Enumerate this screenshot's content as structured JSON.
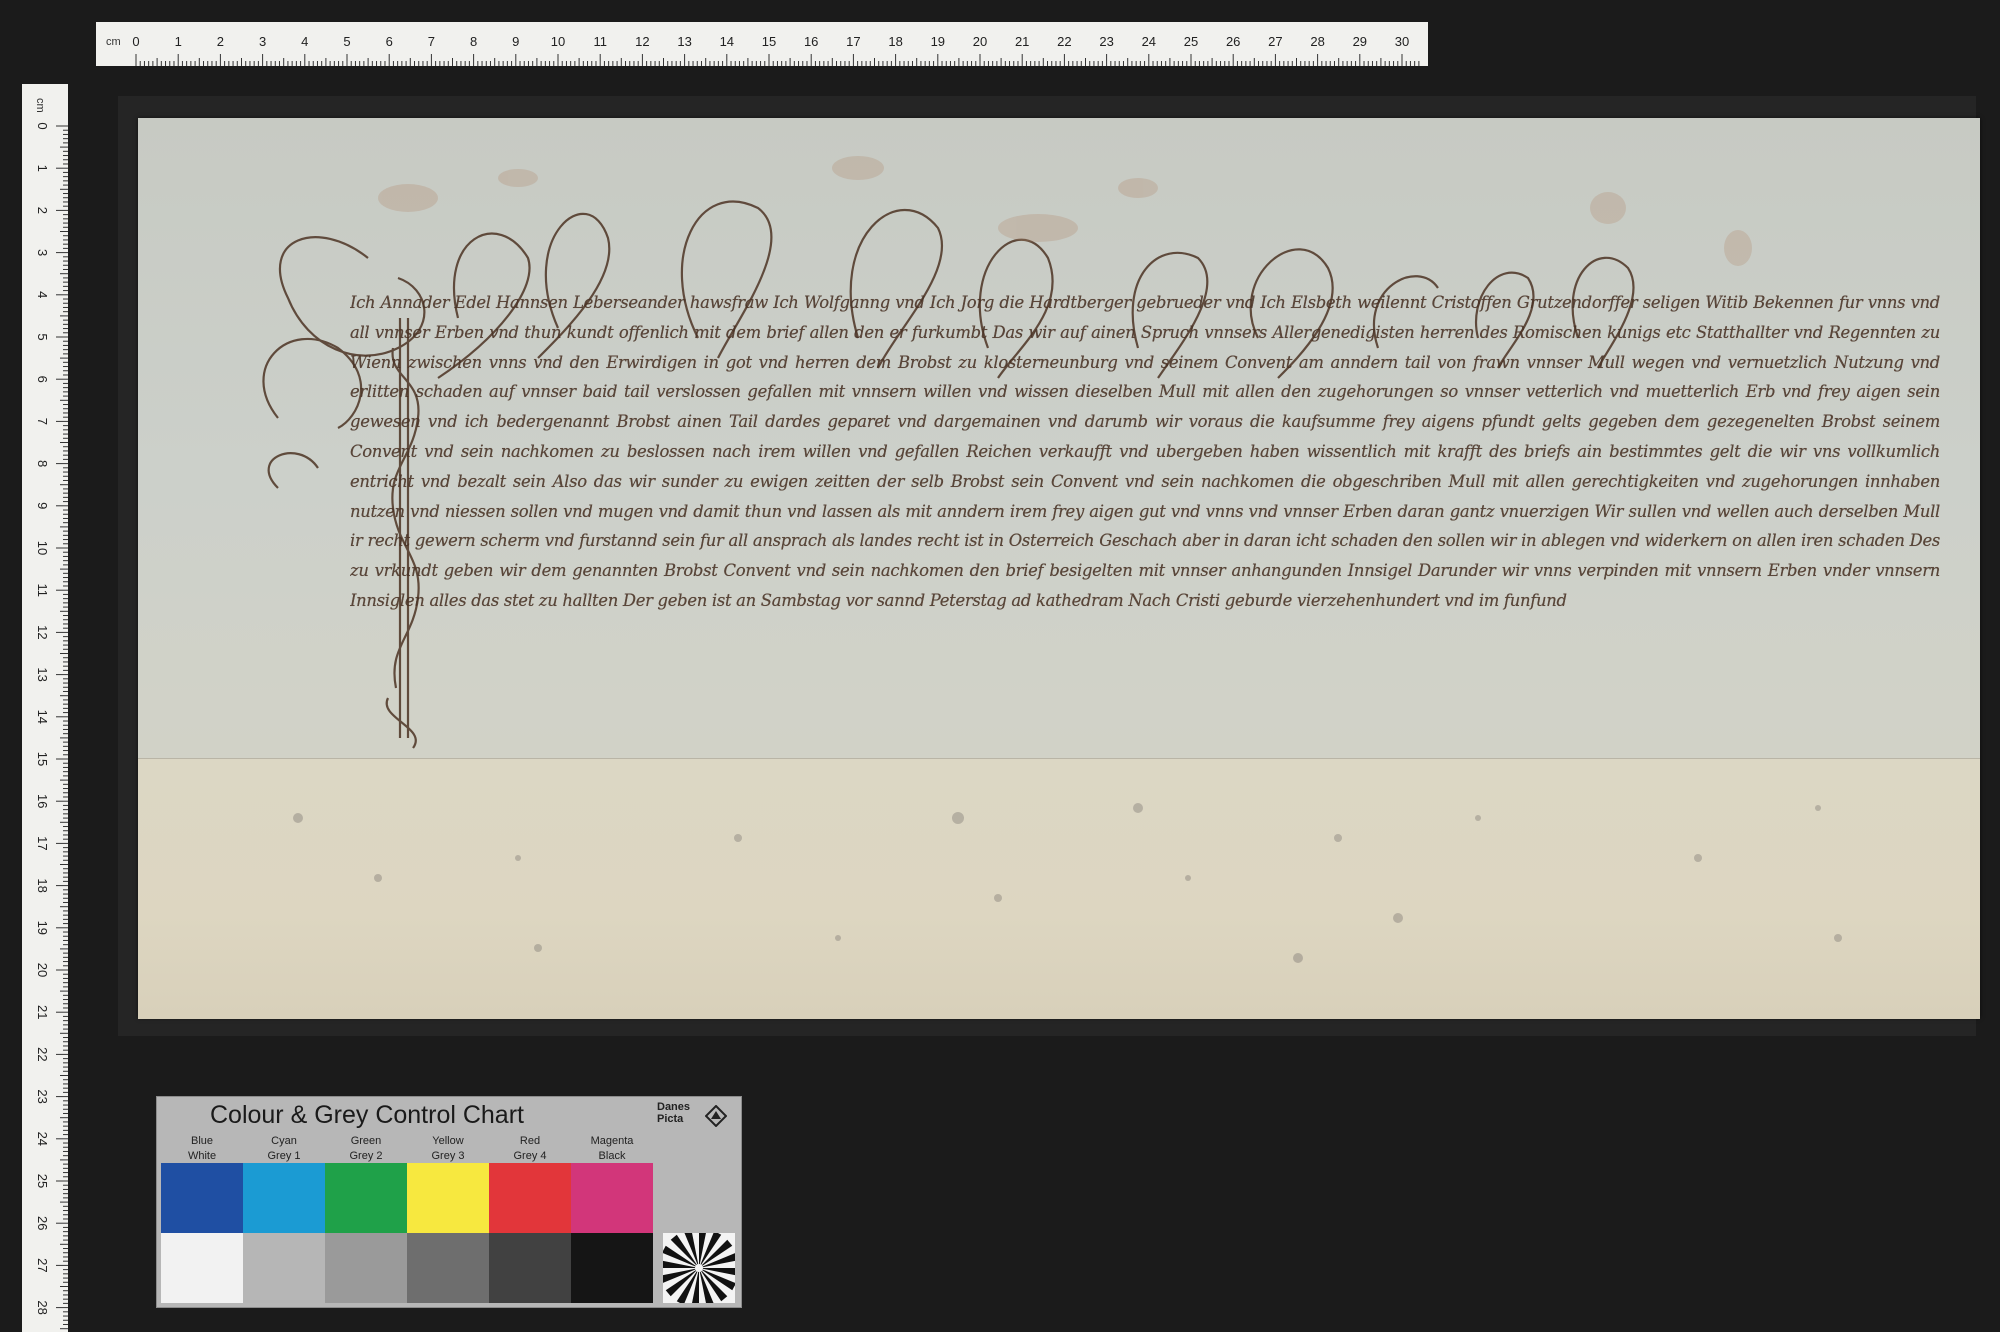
{
  "ruler_horizontal": {
    "unit": "cm",
    "labels": [
      "0",
      "1",
      "2",
      "3",
      "4",
      "5",
      "6",
      "7",
      "8",
      "9",
      "10",
      "11",
      "12",
      "13",
      "14",
      "15",
      "16",
      "17",
      "18",
      "19",
      "20",
      "21",
      "22",
      "23",
      "24",
      "25",
      "26",
      "27",
      "28",
      "29",
      "30"
    ]
  },
  "ruler_vertical": {
    "unit": "cm",
    "labels": [
      "0",
      "1",
      "2",
      "3",
      "4",
      "5",
      "6",
      "7",
      "8",
      "9",
      "10",
      "11",
      "12",
      "13",
      "14",
      "15",
      "16",
      "17",
      "18",
      "19",
      "20",
      "21",
      "22",
      "23",
      "24",
      "25",
      "26",
      "27",
      "28"
    ]
  },
  "charter": {
    "text": "Ich Annader Edel Hannsen Leberseander hawsfraw Ich Wolfganng vnd Ich Jorg die Hardtberger gebrueder vnd Ich Elsbeth weilennt Cristoffen Grutzendorffer seligen Witib Bekennen fur vnns vnd all vnnser Erben vnd thun kundt offenlich mit dem brief allen den er furkumbt Das wir auf ainen Spruch vnnsers Allergenedigisten herren des Romischen kunigs etc Statthallter vnd Regennten zu Wienn zwischen vnns vnd den Erwirdigen in got vnd herren dem Brobst zu klosterneunburg vnd seinem Convent am anndern tail von frawn vnnser Mull wegen vnd vernuetzlich Nutzung vnd erlitten schaden auf vnnser baid tail verslossen gefallen mit vnnsern willen vnd wissen dieselben Mull mit allen den zugehorungen so vnnser vetterlich vnd muetterlich Erb vnd frey aigen sein gewesen vnd ich bedergenannt Brobst ainen Tail dardes geparet vnd dargemainen vnd darumb wir voraus die kaufsumme frey aigens pfundt gelts gegeben dem gezegenelten Brobst seinem Convent vnd sein nachkomen zu beslossen nach irem willen vnd gefallen Reichen verkaufft vnd ubergeben haben wissentlich mit krafft des briefs ain bestimmtes gelt die wir vns vollkumlich entricht vnd bezalt sein Also das wir sunder zu ewigen zeitten der selb Brobst sein Convent vnd sein nachkomen die obgeschriben Mull mit allen gerechtigkeiten vnd zugehorungen innhaben nutzen vnd niessen sollen vnd mugen vnd damit thun vnd lassen als mit anndern irem frey aigen gut vnd vnns vnd vnnser Erben daran gantz vnuerzigen Wir sullen vnd wellen auch derselben Mull ir recht gewern scherm vnd furstannd sein fur all ansprach als landes recht ist in Osterreich Geschach aber in daran icht schaden den sollen wir in ablegen vnd widerkern on allen iren schaden Des zu vrkundt geben wir dem genannten Brobst Convent vnd sein nachkomen den brief besigelten mit vnnser anhangunden Innsigel Darunder wir vnns verpinden mit vnnsern Erben vnder vnnsern Innsiglen alles das stet zu hallten Der geben ist an Sambstag vor sannd Peterstag ad kathedram Nach Cristi geburde vierzehenhundert vnd im funfund"
  },
  "color_chart": {
    "title": "Colour & Grey Control Chart",
    "brand": "Danes\nPicta",
    "top_labels": [
      "Blue",
      "Cyan",
      "Green",
      "Yellow",
      "Red",
      "Magenta"
    ],
    "bottom_labels": [
      "White",
      "Grey 1",
      "Grey 2",
      "Grey 3",
      "Grey 4",
      "Black"
    ],
    "colors": [
      "#1f4fa3",
      "#1b9bd3",
      "#1fa149",
      "#f7e83f",
      "#e2363a",
      "#d2367a"
    ],
    "greys": [
      "#f2f2f2",
      "#b6b6b6",
      "#9a9a9a",
      "#6e6e6e",
      "#414141",
      "#151515"
    ]
  }
}
